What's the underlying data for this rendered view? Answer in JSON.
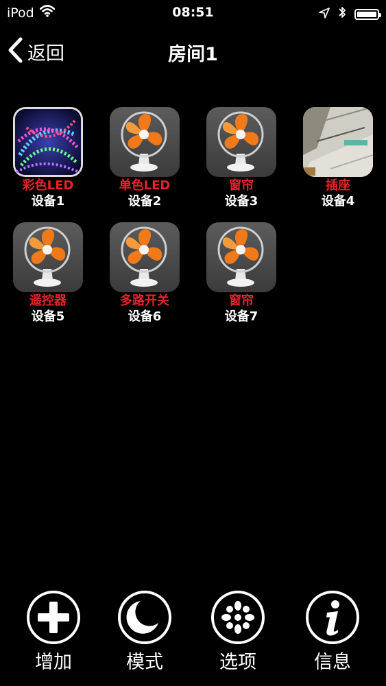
{
  "status_bar": {
    "carrier": "iPod",
    "time": "08:51"
  },
  "nav": {
    "back_label": "返回",
    "title": "房间1"
  },
  "devices": [
    {
      "type": "彩色LED",
      "name": "设备1",
      "icon": "rgb-led-strip-photo"
    },
    {
      "type": "单色LED",
      "name": "设备2",
      "icon": "fan-icon"
    },
    {
      "type": "窗帘",
      "name": "设备3",
      "icon": "fan-icon"
    },
    {
      "type": "插座",
      "name": "设备4",
      "icon": "socket-photo"
    },
    {
      "type": "遥控器",
      "name": "设备5",
      "icon": "fan-icon"
    },
    {
      "type": "多路开关",
      "name": "设备6",
      "icon": "fan-icon"
    },
    {
      "type": "窗帘",
      "name": "设备7",
      "icon": "fan-icon"
    }
  ],
  "toolbar": {
    "add_label": "增加",
    "mode_label": "模式",
    "options_label": "选项",
    "info_label": "信息"
  },
  "colors": {
    "background": "#000000",
    "type_label": "#e8232a",
    "fan_orange": "#f07a1a"
  }
}
